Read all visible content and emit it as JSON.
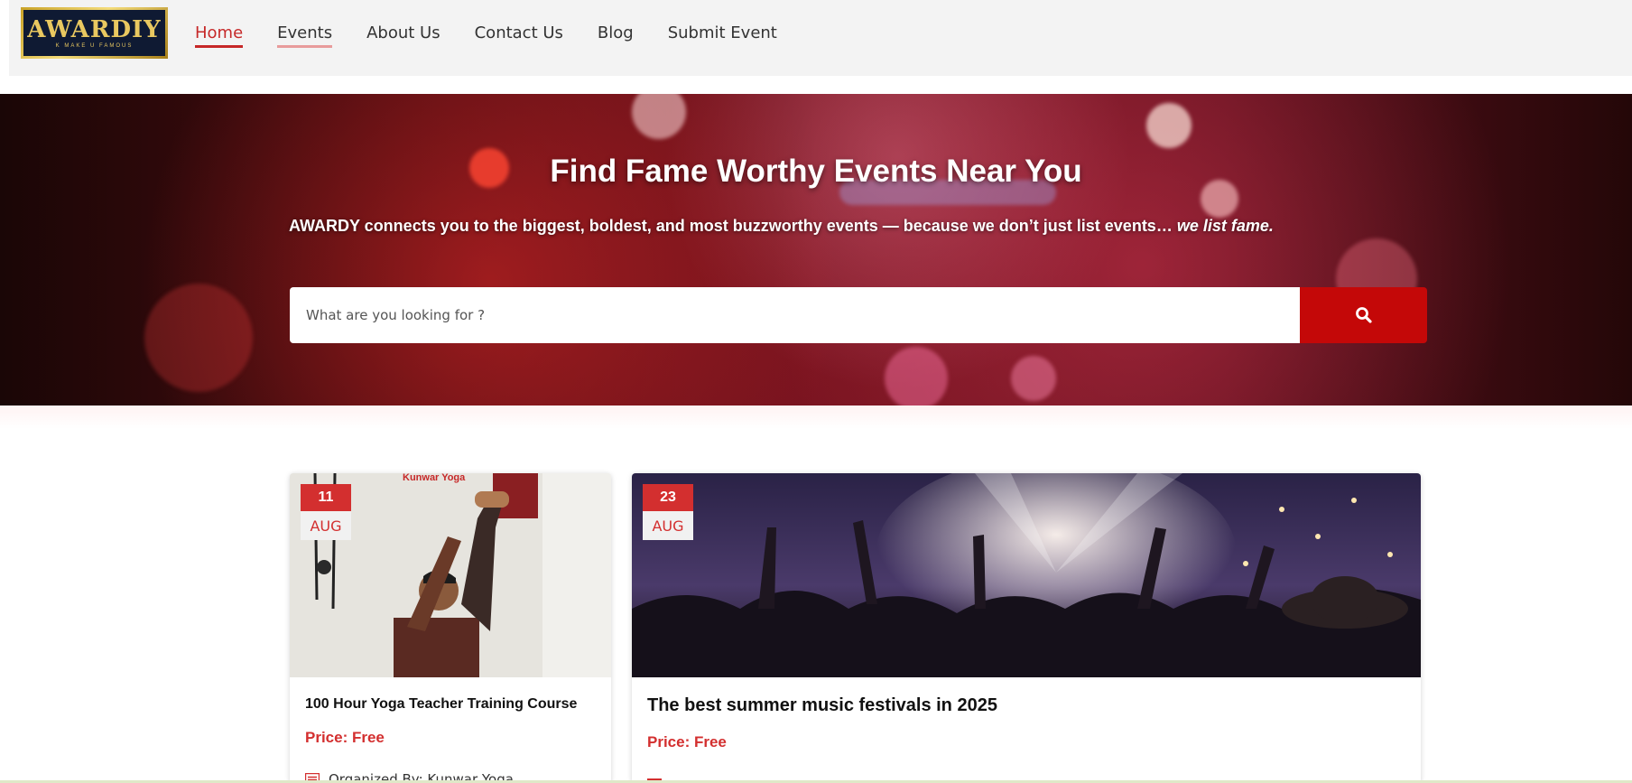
{
  "brand": {
    "logo_text": "AWARDIY",
    "logo_tagline": "K MAKE U FAMOUS"
  },
  "nav": {
    "items": [
      {
        "label": "Home"
      },
      {
        "label": "Events"
      },
      {
        "label": "About Us"
      },
      {
        "label": "Contact Us"
      },
      {
        "label": "Blog"
      },
      {
        "label": "Submit Event"
      }
    ]
  },
  "hero": {
    "title": "Find Fame Worthy Events Near You",
    "subtitle_main": "AWARDY connects you to the biggest, boldest, and most buzzworthy events — because we don’t just list events…",
    "subtitle_emphasis": "we list fame.",
    "search_placeholder": "What are you looking for ?",
    "search_icon": "search-icon"
  },
  "events": [
    {
      "day": "11",
      "month": "AUG",
      "title": "100 Hour Yoga Teacher Training Course",
      "price": "Price: Free",
      "organizer": "Organized By:  Kunwar Yoga",
      "image_caption": "Kunwar Yoga",
      "image_icon": "yoga-photo"
    },
    {
      "day": "23",
      "month": "AUG",
      "title": "The best summer music festivals in 2025",
      "price": "Price: Free",
      "image_icon": "concert-photo"
    }
  ],
  "colors": {
    "accent": "#c62828",
    "search_button": "#c40808",
    "header_bg": "#f3f3f3",
    "logo_gold": "#e9c860",
    "logo_navy": "#0f1a33"
  }
}
